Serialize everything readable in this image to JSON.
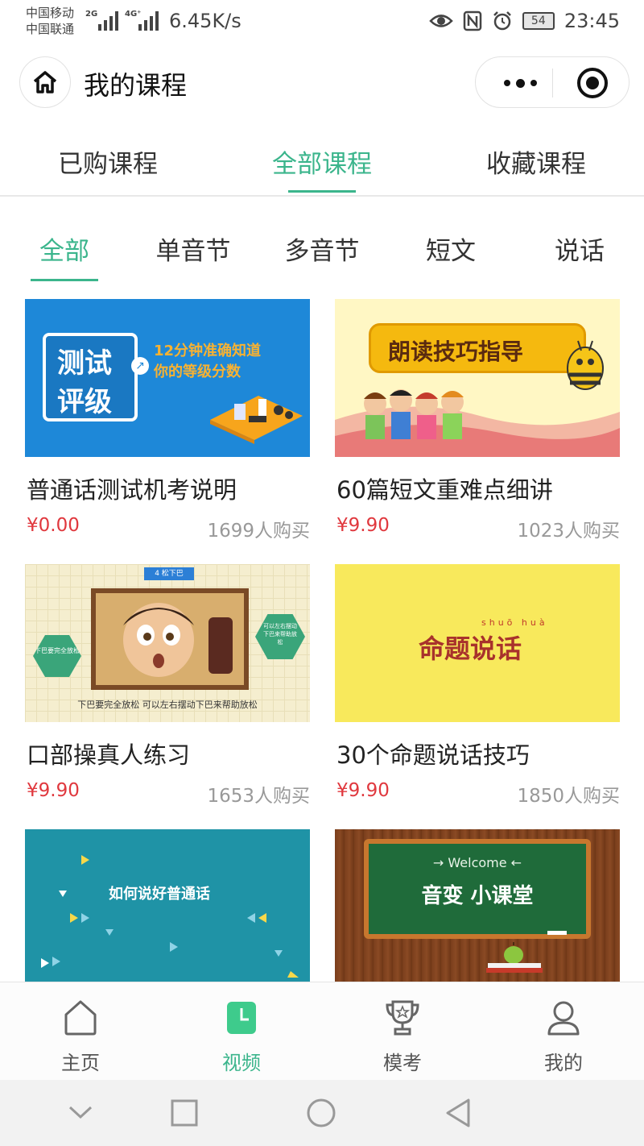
{
  "status_bar": {
    "carrier_1": "中国移动",
    "carrier_2": "中国联通",
    "net_1": "2G",
    "net_2": "4G⁺",
    "speed": "6.45K/s",
    "battery": "54",
    "time": "23:45"
  },
  "header": {
    "title": "我的课程",
    "home_icon": "home-icon",
    "more_icon": "more-dots-icon",
    "close_icon": "miniprogram-close-icon"
  },
  "main_tabs": {
    "active_index": 1,
    "items": [
      {
        "label": "已购课程"
      },
      {
        "label": "全部课程"
      },
      {
        "label": "收藏课程"
      }
    ]
  },
  "category_tabs": {
    "active_index": 0,
    "items": [
      {
        "label": "全部"
      },
      {
        "label": "单音节"
      },
      {
        "label": "多音节"
      },
      {
        "label": "短文"
      },
      {
        "label": "说话"
      }
    ]
  },
  "courses": [
    {
      "title": "普通话测试机考说明",
      "price": "¥0.00",
      "purchases": "1699人购买",
      "thumb": {
        "line1": "测试",
        "line2": "评级",
        "caption1": "12分钟准确知道",
        "caption2": "你的等级分数",
        "bg": "#1e88d8"
      }
    },
    {
      "title": "60篇短文重难点细讲",
      "price": "¥9.90",
      "purchases": "1023人购买",
      "thumb": {
        "banner": "朗读技巧指导",
        "bg": "#fff7c4"
      }
    },
    {
      "title": "口部操真人练习",
      "price": "¥9.90",
      "purchases": "1653人购买",
      "thumb": {
        "tag": "4 松下巴",
        "left_bubble": "下巴要完全放松",
        "right_bubble": "可以左右摆动下巴来帮助放松",
        "caption": "下巴要完全放松 可以左右摆动下巴来帮助放松",
        "bg": "#f5eecf"
      }
    },
    {
      "title": "30个命题说话技巧",
      "price": "¥9.90",
      "purchases": "1850人购买",
      "thumb": {
        "pinyin": "shuō huà",
        "text": "命题说话",
        "bg": "#f8e95c"
      }
    },
    {
      "title": "",
      "price": "",
      "purchases": "",
      "thumb": {
        "text": "如何说好普通话",
        "bg": "#1f93a6"
      }
    },
    {
      "title": "",
      "price": "",
      "purchases": "",
      "thumb": {
        "welcome": "→ Welcome ←",
        "text": "音变 小课堂",
        "bg": "#7a3e1c"
      }
    }
  ],
  "bottom_nav": {
    "active_index": 1,
    "items": [
      {
        "label": "主页",
        "icon": "home-outline-icon"
      },
      {
        "label": "视频",
        "icon": "video-clock-icon"
      },
      {
        "label": "模考",
        "icon": "trophy-icon"
      },
      {
        "label": "我的",
        "icon": "user-icon"
      }
    ]
  },
  "system_nav": {
    "icons": [
      "chevron-down-icon",
      "square-recents-icon",
      "circle-home-icon",
      "triangle-back-icon"
    ]
  },
  "colors": {
    "accent": "#3bb58c",
    "price": "#e0383e",
    "muted": "#999999"
  }
}
